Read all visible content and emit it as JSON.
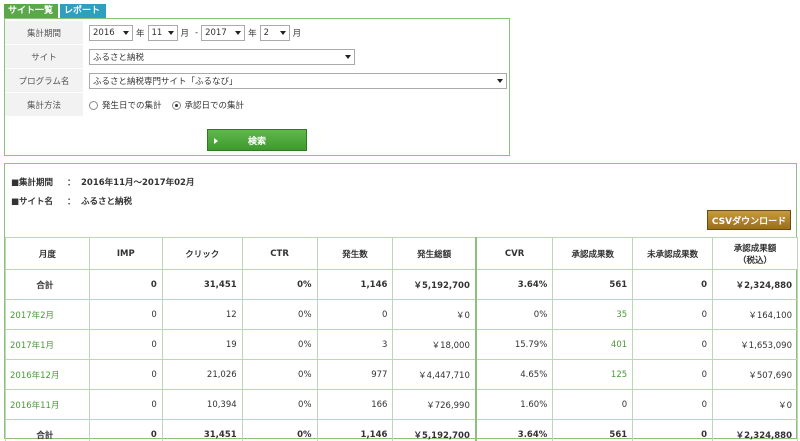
{
  "tabs": {
    "site_list": "サイト一覧",
    "report": "レポート"
  },
  "form": {
    "period_label": "集計期間",
    "period": {
      "start_year": "2016",
      "year_unit": "年",
      "start_month": "11",
      "month_unit": "月",
      "range_sep": "-",
      "end_year": "2017",
      "end_month": "2"
    },
    "site_label": "サイト",
    "site_value": "ふるさと納税",
    "program_label": "プログラム名",
    "program_value": "ふるさと納税専門サイト「ふるなび」",
    "method_label": "集計方法",
    "method_option1": "発生日での集計",
    "method_option2": "承認日での集計",
    "method_selected": "承認日での集計",
    "search_button": "検索"
  },
  "results": {
    "period_key": "■集計期間",
    "period_value": "2016年11月～2017年02月",
    "site_key": "■サイト名",
    "site_value": "ふるさと納税",
    "colon": "：",
    "csv_button": "CSVダウンロード"
  },
  "table": {
    "headers": [
      "月度",
      "IMP",
      "クリック",
      "CTR",
      "発生数",
      "発生総額",
      "CVR",
      "承認成果数",
      "未承認成果数",
      "承認成果額",
      "（税込）"
    ],
    "rows": [
      {
        "month": "合計",
        "imp": "0",
        "click": "31,451",
        "ctr": "0%",
        "occ": "1,146",
        "occ_total": "￥5,192,700",
        "cvr": "3.64%",
        "appr": "561",
        "unappr": "0",
        "appr_amount": "￥2,324,880"
      },
      {
        "month": "2017年2月",
        "imp": "0",
        "click": "12",
        "ctr": "0%",
        "occ": "0",
        "occ_total": "￥0",
        "cvr": "0%",
        "appr": "35",
        "unappr": "0",
        "appr_amount": "￥164,100"
      },
      {
        "month": "2017年1月",
        "imp": "0",
        "click": "19",
        "ctr": "0%",
        "occ": "3",
        "occ_total": "￥18,000",
        "cvr": "15.79%",
        "appr": "401",
        "unappr": "0",
        "appr_amount": "￥1,653,090"
      },
      {
        "month": "2016年12月",
        "imp": "0",
        "click": "21,026",
        "ctr": "0%",
        "occ": "977",
        "occ_total": "￥4,447,710",
        "cvr": "4.65%",
        "appr": "125",
        "unappr": "0",
        "appr_amount": "￥507,690"
      },
      {
        "month": "2016年11月",
        "imp": "0",
        "click": "10,394",
        "ctr": "0%",
        "occ": "166",
        "occ_total": "￥726,990",
        "cvr": "1.60%",
        "appr": "0",
        "unappr": "0",
        "appr_amount": "￥0"
      },
      {
        "month": "合計",
        "imp": "0",
        "click": "31,451",
        "ctr": "0%",
        "occ": "1,146",
        "occ_total": "￥5,192,700",
        "cvr": "3.64%",
        "appr": "561",
        "unappr": "0",
        "appr_amount": "￥2,324,880"
      }
    ]
  },
  "colors": {
    "green": "#5aa84a",
    "blue": "#2f9fc0",
    "link": "#4a9a3a",
    "csv": "#9a6e1a"
  }
}
